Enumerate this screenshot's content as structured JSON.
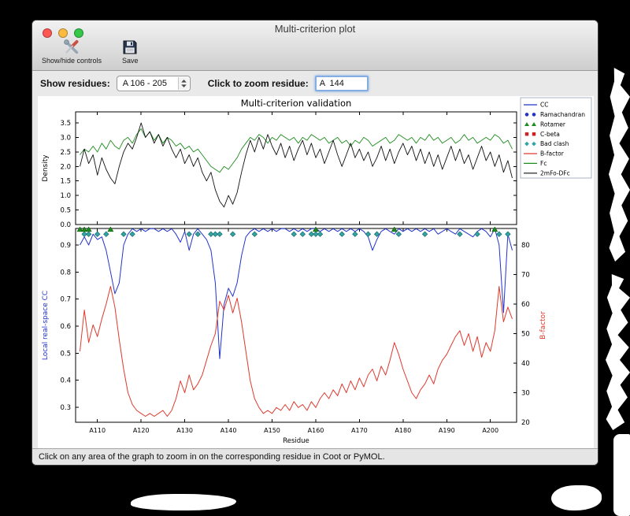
{
  "window": {
    "title": "Multi-criterion plot",
    "traffic_lights": {
      "close": "#fc5753",
      "minimize": "#fdbc40",
      "zoom": "#34c84a"
    }
  },
  "toolbar": {
    "show_hide_label": "Show/hide controls",
    "save_label": "Save"
  },
  "controls": {
    "show_residues_label": "Show residues:",
    "residue_range_value": "A 106 - 205",
    "zoom_residue_label": "Click to zoom residue:",
    "zoom_residue_value": "A  144"
  },
  "statusbar": {
    "text": "Click on any area of the graph to zoom in on the corresponding residue in Coot or PyMOL."
  },
  "chart_data": {
    "type": "line",
    "title": "Multi-criterion validation",
    "xlabel": "Residue",
    "x": {
      "start": 106,
      "end": 205,
      "step": 1
    },
    "xlim": [
      105,
      206
    ],
    "x_ticks": [
      110,
      120,
      130,
      140,
      150,
      160,
      170,
      180,
      190,
      200
    ],
    "x_tick_labels": [
      "A110",
      "A120",
      "A130",
      "A140",
      "A150",
      "A160",
      "A170",
      "A180",
      "A190",
      "A200"
    ],
    "legend": {
      "position": "upper right",
      "entries": [
        {
          "label": "CC",
          "marker": "line",
          "color": "#2233cc"
        },
        {
          "label": "Ramachandran",
          "marker": "circle",
          "color": "#2233cc"
        },
        {
          "label": "Rotamer",
          "marker": "triangle",
          "color": "#1f8c1f"
        },
        {
          "label": "C-beta",
          "marker": "square",
          "color": "#cc2222"
        },
        {
          "label": "Bad clash",
          "marker": "diamond",
          "color": "#2fa5a5"
        },
        {
          "label": "B-factor",
          "marker": "line",
          "color": "#e0392e"
        },
        {
          "label": "Fc",
          "marker": "line",
          "color": "#1f8c1f"
        },
        {
          "label": "2mFo-DFc",
          "marker": "line",
          "color": "#111111"
        }
      ]
    },
    "subplots": [
      {
        "ylabel": "Density",
        "ylabel_color": "#000000",
        "ylim": [
          0,
          3.88
        ],
        "yticks": [
          0.0,
          0.5,
          1.0,
          1.5,
          2.0,
          2.5,
          3.0,
          3.5
        ],
        "series": [
          {
            "name": "Fc",
            "color": "#1f8c1f",
            "values": [
              2.4,
              2.6,
              2.5,
              2.7,
              2.5,
              2.8,
              2.6,
              2.9,
              2.7,
              2.6,
              2.9,
              3.0,
              2.8,
              3.1,
              3.3,
              3.0,
              3.2,
              2.9,
              3.1,
              2.8,
              3.0,
              2.9,
              2.7,
              2.8,
              2.6,
              2.7,
              2.5,
              2.6,
              2.4,
              2.2,
              2.0,
              1.9,
              1.8,
              2.0,
              1.9,
              2.1,
              2.3,
              2.6,
              2.8,
              3.0,
              2.9,
              3.1,
              3.0,
              2.8,
              3.0,
              2.9,
              3.1,
              3.0,
              2.9,
              3.0,
              2.8,
              3.0,
              2.9,
              3.1,
              3.0,
              2.9,
              3.0,
              2.8,
              2.9,
              3.0,
              2.8,
              2.9,
              2.7,
              2.9,
              2.8,
              3.0,
              2.9,
              2.7,
              2.8,
              2.9,
              3.0,
              2.8,
              2.9,
              3.1,
              3.0,
              2.9,
              3.0,
              2.8,
              3.0,
              2.9,
              3.1,
              2.9,
              3.0,
              2.8,
              2.9,
              3.0,
              2.8,
              2.9,
              3.1,
              2.9,
              3.0,
              2.8,
              2.9,
              3.0,
              2.9,
              3.1,
              3.0,
              2.8,
              2.9,
              2.6
            ]
          },
          {
            "name": "2mFo-DFc",
            "color": "#111111",
            "values": [
              2.0,
              2.6,
              2.1,
              2.4,
              1.7,
              2.3,
              1.9,
              1.6,
              1.4,
              2.0,
              2.5,
              2.8,
              2.6,
              3.0,
              3.5,
              3.0,
              3.2,
              2.8,
              3.1,
              2.7,
              3.0,
              2.6,
              2.3,
              2.6,
              2.1,
              2.4,
              2.0,
              2.3,
              1.8,
              1.5,
              1.8,
              1.2,
              0.8,
              0.6,
              1.0,
              0.7,
              1.1,
              1.8,
              2.4,
              2.9,
              2.5,
              3.0,
              2.6,
              3.1,
              2.7,
              2.4,
              2.8,
              2.3,
              2.7,
              2.2,
              2.6,
              2.9,
              2.4,
              2.8,
              2.3,
              2.6,
              2.1,
              2.5,
              2.9,
              2.4,
              2.0,
              2.4,
              2.8,
              2.3,
              2.6,
              2.2,
              2.5,
              2.0,
              2.3,
              2.7,
              2.2,
              2.6,
              2.1,
              2.5,
              2.8,
              2.4,
              2.7,
              2.2,
              2.6,
              2.1,
              2.5,
              2.0,
              2.4,
              1.9,
              2.3,
              2.7,
              2.2,
              2.6,
              2.1,
              2.4,
              1.9,
              2.3,
              2.7,
              2.2,
              2.5,
              2.0,
              2.4,
              1.8,
              2.2,
              1.6
            ]
          }
        ]
      },
      {
        "left_ylabel": "Local real-space CC",
        "left_ylabel_color": "#2233cc",
        "left_ylim": [
          0.245,
          0.961
        ],
        "left_yticks": [
          0.3,
          0.4,
          0.5,
          0.6,
          0.7,
          0.8,
          0.9
        ],
        "right_ylabel": "B-factor",
        "right_ylabel_color": "#e0392e",
        "right_ylim": [
          20,
          85.6
        ],
        "right_yticks": [
          20,
          30,
          40,
          50,
          60,
          70,
          80
        ],
        "series": [
          {
            "name": "CC",
            "axis": "left",
            "color": "#2233cc",
            "values": [
              0.9,
              0.93,
              0.9,
              0.94,
              0.92,
              0.93,
              0.88,
              0.8,
              0.72,
              0.76,
              0.9,
              0.94,
              0.96,
              0.95,
              0.96,
              0.95,
              0.96,
              0.96,
              0.95,
              0.96,
              0.95,
              0.96,
              0.94,
              0.91,
              0.95,
              0.88,
              0.94,
              0.96,
              0.94,
              0.92,
              0.88,
              0.76,
              0.48,
              0.68,
              0.74,
              0.71,
              0.76,
              0.86,
              0.93,
              0.95,
              0.96,
              0.95,
              0.96,
              0.95,
              0.96,
              0.95,
              0.96,
              0.96,
              0.95,
              0.96,
              0.95,
              0.96,
              0.95,
              0.96,
              0.96,
              0.95,
              0.96,
              0.95,
              0.96,
              0.95,
              0.96,
              0.95,
              0.96,
              0.95,
              0.96,
              0.95,
              0.93,
              0.88,
              0.92,
              0.95,
              0.96,
              0.95,
              0.94,
              0.96,
              0.95,
              0.96,
              0.95,
              0.96,
              0.95,
              0.96,
              0.95,
              0.96,
              0.94,
              0.95,
              0.96,
              0.95,
              0.94,
              0.96,
              0.95,
              0.94,
              0.93,
              0.95,
              0.96,
              0.95,
              0.93,
              0.96,
              0.9,
              0.65,
              0.94,
              0.88
            ]
          },
          {
            "name": "B-factor",
            "axis": "right",
            "color": "#e0392e",
            "values": [
              44,
              58,
              47,
              53,
              49,
              55,
              60,
              66,
              59,
              48,
              38,
              30,
              26,
              24,
              23,
              22,
              23,
              22,
              23,
              24,
              22,
              24,
              28,
              34,
              30,
              36,
              31,
              33,
              36,
              41,
              46,
              50,
              61,
              58,
              63,
              57,
              62,
              54,
              44,
              34,
              28,
              25,
              23,
              24,
              23,
              25,
              24,
              26,
              24,
              27,
              25,
              26,
              24,
              27,
              25,
              28,
              30,
              28,
              31,
              29,
              33,
              30,
              34,
              31,
              35,
              32,
              36,
              38,
              34,
              39,
              36,
              41,
              47,
              43,
              38,
              34,
              30,
              28,
              31,
              33,
              36,
              33,
              38,
              41,
              43,
              46,
              49,
              51,
              46,
              50,
              44,
              49,
              42,
              47,
              44,
              51,
              66,
              54,
              59,
              55
            ]
          }
        ],
        "outlier_markers": [
          {
            "name": "Bad clash",
            "shape": "diamond",
            "color": "#2fa5a5",
            "edge": "#1b6b6b",
            "y": 0.94,
            "residues": [
              107,
              108,
              110,
              112,
              116,
              118,
              131,
              133,
              136,
              137,
              138,
              141,
              146,
              155,
              157,
              159,
              160,
              161,
              166,
              169,
              172,
              174,
              179,
              185,
              193,
              197,
              202,
              204
            ]
          },
          {
            "name": "Rotamer",
            "shape": "triangle",
            "color": "#1f8c1f",
            "edge": "#0f5c0f",
            "y": 0.9575,
            "residues": [
              106,
              107,
              108,
              113,
              160,
              178,
              201
            ]
          }
        ]
      }
    ]
  }
}
